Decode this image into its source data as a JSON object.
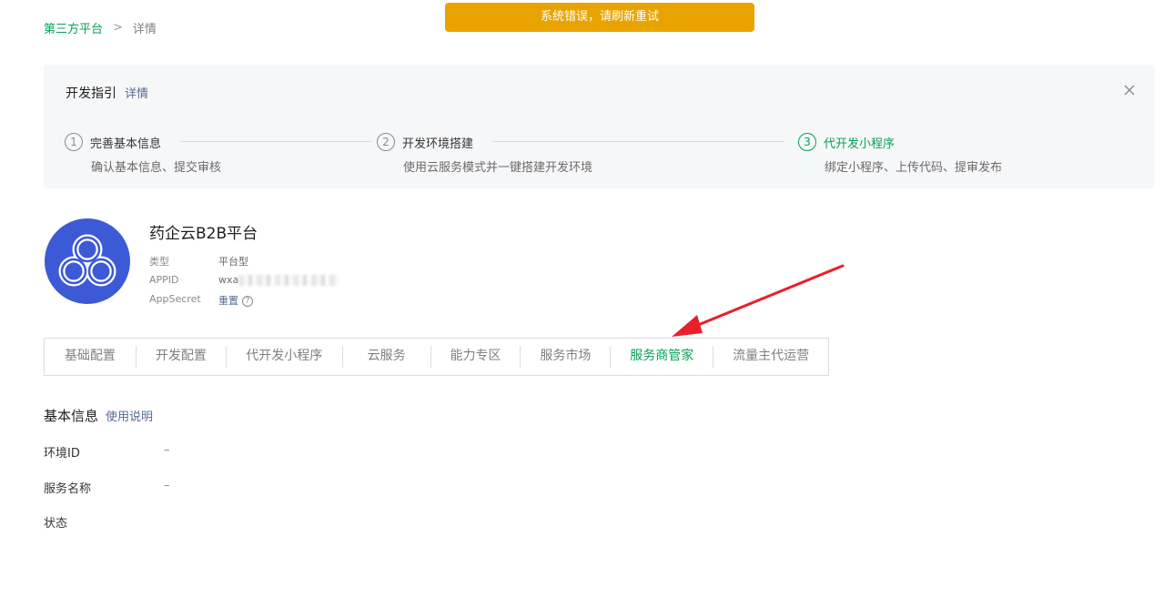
{
  "toast": {
    "message": "系统错误，请刷新重试",
    "color": "#e9a300"
  },
  "breadcrumb": {
    "parent": "第三方平台",
    "separator": ">",
    "current": "详情"
  },
  "guide": {
    "title": "开发指引",
    "detail_link": "详情",
    "steps": [
      {
        "num": "1",
        "title": "完善基本信息",
        "desc": "确认基本信息、提交审核"
      },
      {
        "num": "2",
        "title": "开发环境搭建",
        "desc": "使用云服务模式并一键搭建开发环境"
      },
      {
        "num": "3",
        "title": "代开发小程序",
        "desc": "绑定小程序、上传代码、提审发布"
      }
    ]
  },
  "app": {
    "name": "药企云B2B平台",
    "type_label": "类型",
    "type_value": "平台型",
    "appid_label": "APPID",
    "appid_value": "wxa",
    "secret_label": "AppSecret",
    "secret_action": "重置",
    "help_glyph": "?"
  },
  "tabs": [
    {
      "label": "基础配置"
    },
    {
      "label": "开发配置"
    },
    {
      "label": "代开发小程序"
    },
    {
      "label": "云服务"
    },
    {
      "label": "能力专区"
    },
    {
      "label": "服务市场"
    },
    {
      "label": "服务商管家"
    },
    {
      "label": "流量主代运营"
    }
  ],
  "basic_info": {
    "title": "基本信息",
    "help_link": "使用说明",
    "rows": [
      {
        "label": "环境ID",
        "value": "–"
      },
      {
        "label": "服务名称",
        "value": "–"
      },
      {
        "label": "状态",
        "value": ""
      }
    ]
  },
  "colors": {
    "accent_green": "#07a155",
    "link_blue": "#576b95",
    "logo_blue": "#3d5ad6",
    "annotation_red": "#e8202a"
  },
  "icons": {
    "close": "close-icon",
    "help": "help-icon",
    "logo": "app-logo-icon"
  }
}
